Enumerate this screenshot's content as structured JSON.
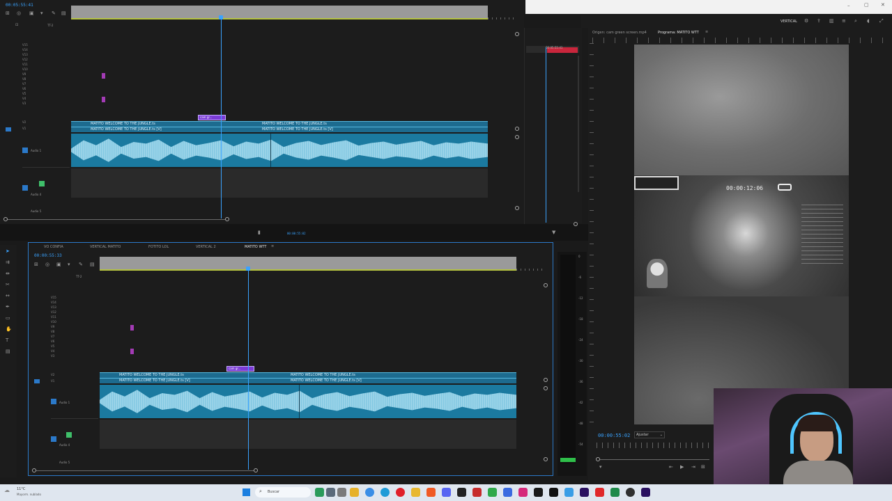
{
  "top_timeline": {
    "timecode": "00:05:55:41",
    "track_name": "TT-2",
    "video_tracks": [
      "V15",
      "V14",
      "V13",
      "V12",
      "V11",
      "V10",
      "V9",
      "V8",
      "V7",
      "V6",
      "V5",
      "V4",
      "V3",
      "V2",
      "V1"
    ],
    "audio_tracks": [
      "A1",
      "A2",
      "A3",
      "A4",
      "A5"
    ],
    "audio1_label": "Audio 1",
    "audio4_label": "Audio 4",
    "audio5_label": "Audio 5",
    "clip_v2_a": "MATITO WELCOME TO THE JUNGLE.ts",
    "clip_v1_a": "MATITO WELCOME TO THE JUNGLE.ts [V]",
    "clip_v2_b": "MATITO WELCOME TO THE JUNGLE.ts",
    "clip_v1_b": "MATITO WELCOME TO THE JUNGLE.ts [V]",
    "small_clip": "cam gr...",
    "mini_timecode": "00:05:55:41",
    "fx": "fx",
    "m": "M"
  },
  "bottom_timeline": {
    "tabs": [
      "VO CONFIA",
      "VERTICAL MATITO",
      "FOTITO LOL",
      "VERTICAL 2",
      "MATITO WTT"
    ],
    "active_tab": "MATITO WTT",
    "timecode": "00:00:55:33",
    "track_name": "TT-2",
    "video_tracks": [
      "V15",
      "V14",
      "V13",
      "V12",
      "V11",
      "V10",
      "V9",
      "V8",
      "V7",
      "V6",
      "V5",
      "V4",
      "V3",
      "V2",
      "V1"
    ],
    "audio1_label": "Audio 1",
    "audio4_label": "Audio 4",
    "audio5_label": "Audio 5",
    "clip_v2_a": "MATITO WELCOME TO THE JUNGLE.ts",
    "clip_v1_a": "MATITO WELCOME TO THE JUNGLE.ts [V]",
    "clip_v2_b": "MATITO WELCOME TO THE JUNGLE.ts",
    "clip_v1_b": "MATITO WELCOME TO THE JUNGLE.ts [V]",
    "small_clip": "cam gr...",
    "fx": "fx",
    "m": "M",
    "meter_scale": [
      "0",
      "-6",
      "-12",
      "-18",
      "-24",
      "-30",
      "-36",
      "-42",
      "-48",
      "-54"
    ]
  },
  "middle_bar": {
    "timecode": "00:00:55:02"
  },
  "program_monitor": {
    "source_label": "Origen: cam green screen.mp4",
    "program_label": "Programa: MATITO WTT",
    "sequence_label": "VERTICAL",
    "overlay_timer": "00:00:12:06",
    "timecode": "00:00:55:02",
    "fit_label": "Ajustar"
  },
  "taskbar": {
    "weather_temp": "11°C",
    "weather_desc": "Mayorm. nublado",
    "search_placeholder": "Buscar"
  },
  "colors": {
    "accent": "#3aa3ff",
    "clip_blue": "#1d6b8f",
    "marker_purple": "#a33bb5",
    "audio_wave": "#bfe8f6"
  }
}
